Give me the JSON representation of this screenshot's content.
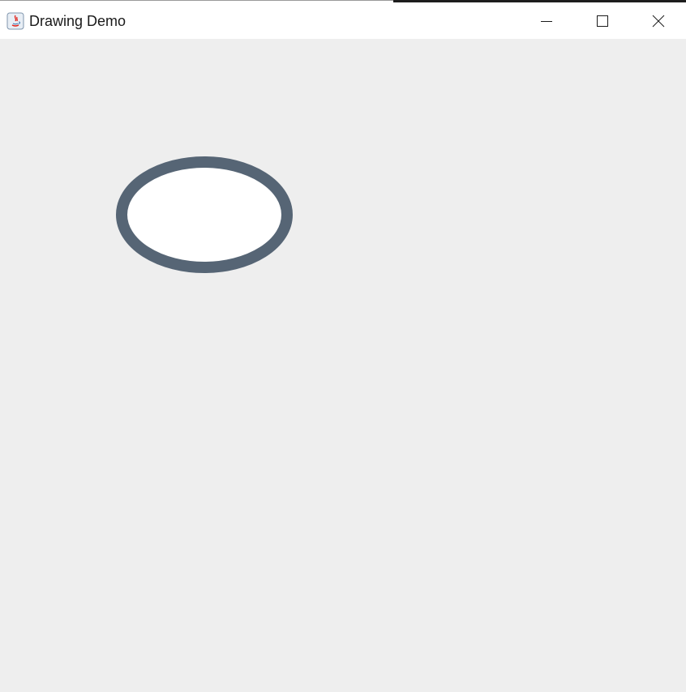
{
  "window": {
    "title": "Drawing Demo",
    "app_icon": "java-icon",
    "controls": {
      "minimize_icon": "minimize-icon",
      "maximize_icon": "maximize-icon",
      "close_icon": "close-icon"
    }
  },
  "canvas": {
    "background": "#eeeeee",
    "shapes": [
      {
        "type": "ellipse",
        "fill": "#ffffff",
        "stroke": "#566575"
      }
    ]
  }
}
